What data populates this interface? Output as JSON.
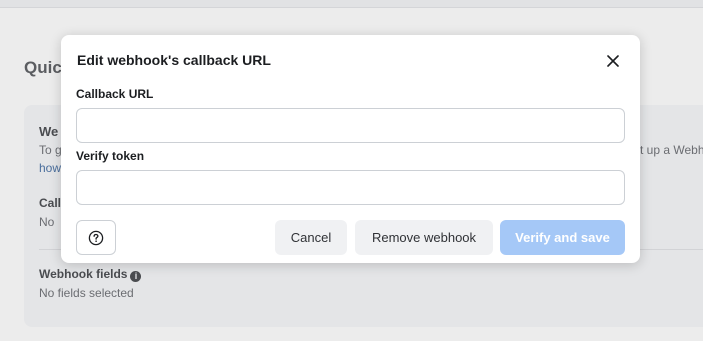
{
  "background": {
    "section_title": "Quic",
    "card_heading": "We",
    "card_text_1_left": "To g",
    "card_text_1_right": "t up a Webh",
    "card_link": "how",
    "callback_label": "Call",
    "callback_value": "No",
    "webhook_fields_label": "Webhook fields",
    "webhook_fields_value": "No fields selected"
  },
  "modal": {
    "title": "Edit webhook's callback URL",
    "callback_url_label": "Callback URL",
    "callback_url_value": "",
    "verify_token_label": "Verify token",
    "verify_token_value": "",
    "cancel_label": "Cancel",
    "remove_label": "Remove webhook",
    "verify_label": "Verify and save"
  },
  "colors": {
    "primary_disabled": "#a5c8f7",
    "link": "#4a6e9c"
  },
  "icons": {
    "close": "close-icon",
    "help": "question-circle-icon",
    "info": "info-icon"
  }
}
